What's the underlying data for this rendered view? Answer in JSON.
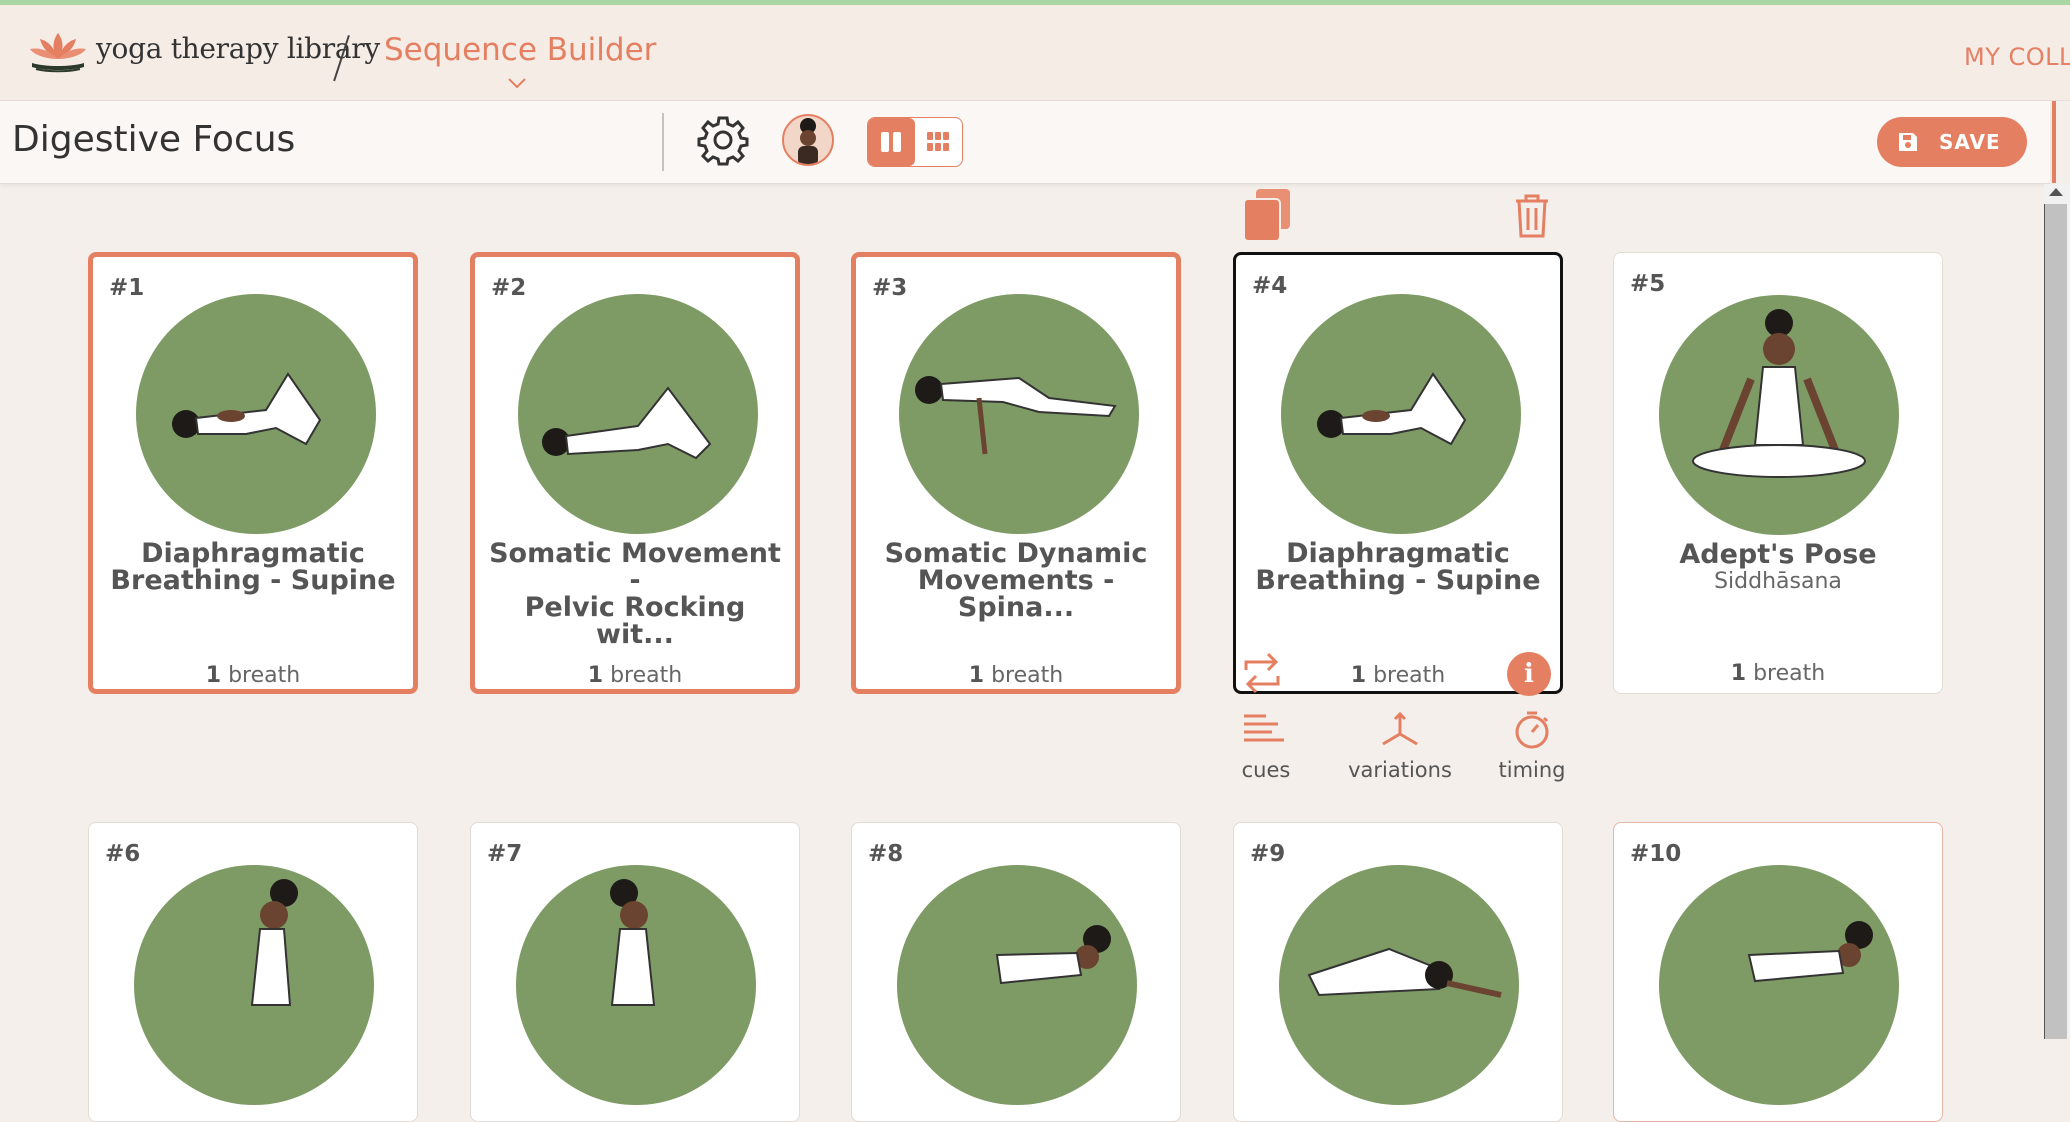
{
  "header": {
    "brand": "yoga therapy library",
    "page_title": "Sequence Builder",
    "my_collection": "MY COLL"
  },
  "toolbar": {
    "sequence_name": "Digestive Focus",
    "save_label": "SAVE"
  },
  "cards": [
    {
      "num": "#1",
      "name_line1": "Diaphragmatic",
      "name_line2": "Breathing - Supine",
      "sanskrit": "",
      "dur_num": "1",
      "dur_unit": "breath"
    },
    {
      "num": "#2",
      "name_line1": "Somatic Movement -",
      "name_line2": "Pelvic Rocking wit...",
      "sanskrit": "",
      "dur_num": "1",
      "dur_unit": "breath"
    },
    {
      "num": "#3",
      "name_line1": "Somatic Dynamic",
      "name_line2": "Movements - Spina...",
      "sanskrit": "",
      "dur_num": "1",
      "dur_unit": "breath"
    },
    {
      "num": "#4",
      "name_line1": "Diaphragmatic",
      "name_line2": "Breathing - Supine",
      "sanskrit": "",
      "dur_num": "1",
      "dur_unit": "breath"
    },
    {
      "num": "#5",
      "name_line1": "Adept's Pose",
      "name_line2": "",
      "sanskrit": "Siddhāsana",
      "dur_num": "1",
      "dur_unit": "breath"
    },
    {
      "num": "#6"
    },
    {
      "num": "#7"
    },
    {
      "num": "#8"
    },
    {
      "num": "#9"
    },
    {
      "num": "#10"
    }
  ],
  "card_options": {
    "cues": "cues",
    "variations": "variations",
    "timing": "timing",
    "info": "i"
  },
  "colors": {
    "accent": "#e57f62",
    "pose_circle": "#7e9b65",
    "background": "#f4efea"
  }
}
